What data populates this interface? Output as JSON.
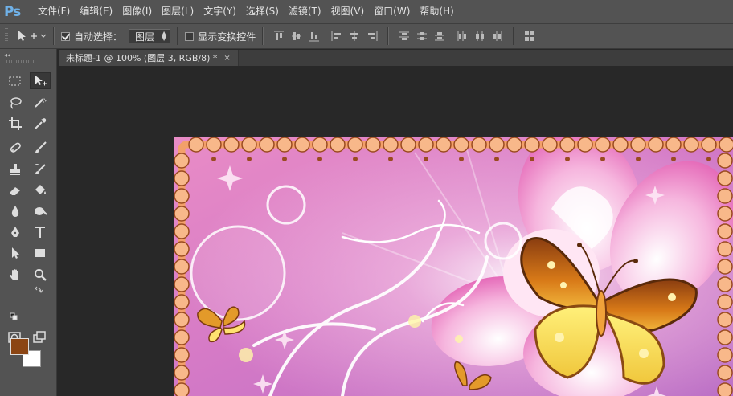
{
  "app": {
    "logo": "Ps"
  },
  "menu": [
    "文件(F)",
    "编辑(E)",
    "图像(I)",
    "图层(L)",
    "文字(Y)",
    "选择(S)",
    "滤镜(T)",
    "视图(V)",
    "窗口(W)",
    "帮助(H)"
  ],
  "options": {
    "auto_select_label": "自动选择：",
    "auto_select_checked": true,
    "auto_select_value": "图层",
    "show_transform_label": "显示变换控件",
    "show_transform_checked": false
  },
  "document": {
    "tab_title": "未标题-1 @ 100% (图层 3, RGB/8) *",
    "close_glyph": "×"
  },
  "colors": {
    "foreground": "#8b4513",
    "background": "#ffffff",
    "accent": "#6fb1e8"
  },
  "tools": [
    "rect-marquee",
    "move",
    "lasso",
    "quick-selection",
    "crop",
    "eyedropper",
    "spot-healing",
    "brush",
    "clone-stamp",
    "history-brush",
    "eraser",
    "paint-bucket",
    "blur",
    "dodge",
    "pen",
    "type",
    "path-selection",
    "rectangle",
    "hand",
    "zoom"
  ]
}
